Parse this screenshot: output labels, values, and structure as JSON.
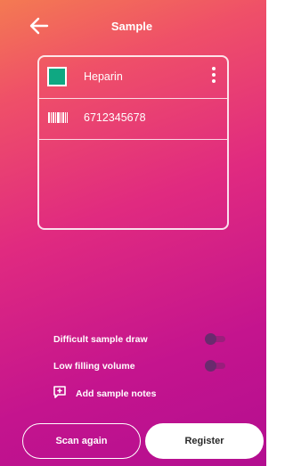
{
  "header": {
    "title": "Sample",
    "back_icon": "arrow-left-icon"
  },
  "card": {
    "rows": [
      {
        "label": "Heparin",
        "swatch_color": "#0fa882",
        "icon": "color-swatch-icon",
        "menu_icon": "more-vertical-icon"
      },
      {
        "label": "6712345678",
        "icon": "barcode-icon"
      }
    ]
  },
  "options": {
    "difficult_draw": {
      "label": "Difficult sample draw",
      "enabled": false
    },
    "low_volume": {
      "label": "Low filling volume",
      "enabled": false
    },
    "notes": {
      "label": "Add sample notes",
      "icon": "add-note-icon"
    }
  },
  "actions": {
    "scan_again": "Scan again",
    "register": "Register"
  },
  "colors": {
    "gradient_top": "#f47a52",
    "gradient_bottom": "#b30e90",
    "toggle_off": "#6a2a6e"
  }
}
